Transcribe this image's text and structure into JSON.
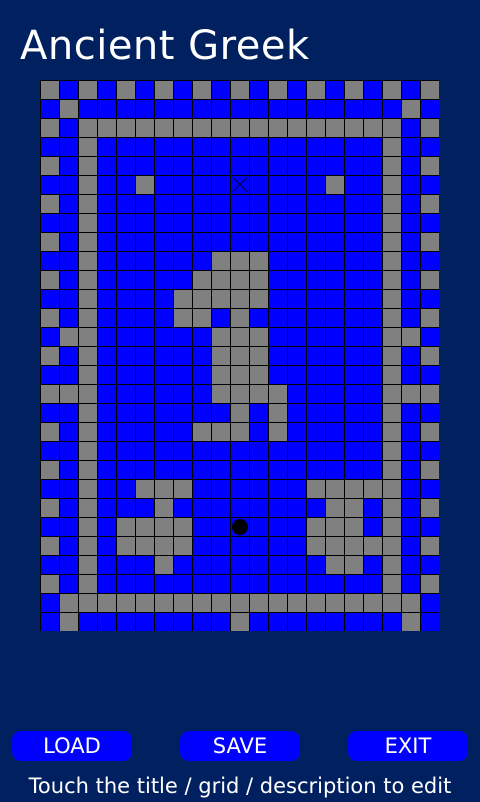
{
  "app": {
    "title": "Ancient Greek",
    "description": "Touch the title / grid / description to edit"
  },
  "buttons": {
    "load": "LOAD",
    "save": "SAVE",
    "exit": "EXIT"
  },
  "colors": {
    "background": "#002060",
    "blue_tile": "#0000ff",
    "gray_tile": "#808080",
    "grid_line": "#000000"
  },
  "board": {
    "columns": 21,
    "rows": 29,
    "legend": {
      "B": "blue tile",
      "G": "gray tile",
      "X": "crossed target tile",
      "O": "player ball"
    },
    "tiles": [
      "GBGBGBGBGBGBGBGBGBGBG",
      "BGBBBBBBBBBBBBBBBBBGB",
      "GBGGGGGGGGGGGGGGGGGBG",
      "BBGBBBBBBBBBBBBBBBGBB",
      "GBGBBBBBBBBBBBBBBBGBG",
      "BBGBBGBBBBXBBBBGBBGBB",
      "GBGBBBBBBBBBBBBBBBGBG",
      "BBGBBBBBBBBBBBBBBBGBB",
      "GBGBBBBBBBBBBBBBBBGBG",
      "BBGBBBBBBGGGBBBBBBGBB",
      "GBGBBBBBGGGGBBBBBBGBG",
      "BBGBBBBGGGGGBBBBBBGBB",
      "GBGBBBBGGBGBBBBBBBGBG",
      "BGGBBBBBBGGGBBBBBBGGB",
      "GBGBBBBBBGGGBBBBBBGBG",
      "BBGBBBBBBGGGBBBBBBGBB",
      "GGGBBBBBBGGGGBBBBBGGG",
      "BBGBBBBBBBGBGBBBBBGBB",
      "GBGBBBBBGGGBGBBBBBGBG",
      "BBGBBBBBBBBBBBBBBBGBB",
      "GBGBBBBBBBBBBBBBBBGBG",
      "BBGBBGGGBBBBBBGGGGGBB",
      "GBGBBBGBBBBBBBBGGBGBG",
      "BBGBGGGGBBOBBBGGGBGBB",
      "GBGBGGGGBBBBBBGGGGGBG",
      "BBGBBBGBBBBBBBBGGBGBB",
      "GBGBBBBBBBBBBBBBBBGBG",
      "BGGGGGGGGGGGGGGGGGGGB",
      "BGBBBBBBBBGBBBBBBBBGB"
    ]
  }
}
